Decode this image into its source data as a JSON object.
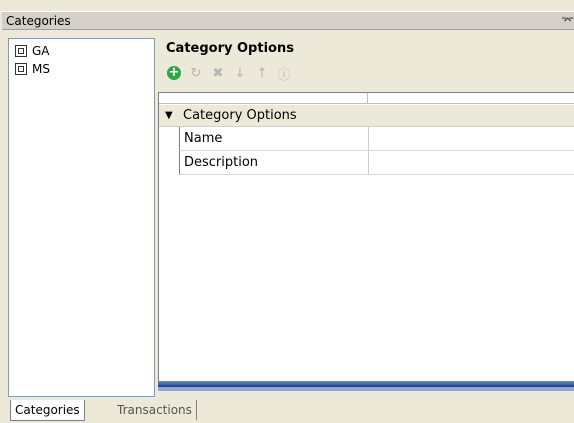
{
  "window": {
    "title": "Categories"
  },
  "tree": {
    "items": [
      {
        "label": "GA"
      },
      {
        "label": "MS"
      }
    ]
  },
  "options": {
    "title": "Category Options",
    "toolbar": [
      {
        "icon": "add-icon",
        "enabled": true
      },
      {
        "icon": "refresh-icon",
        "enabled": false
      },
      {
        "icon": "delete-icon",
        "enabled": false
      },
      {
        "icon": "arrow-down-icon",
        "enabled": false
      },
      {
        "icon": "arrow-up-icon",
        "enabled": false
      },
      {
        "icon": "info-icon",
        "enabled": false
      }
    ]
  },
  "grid": {
    "category": "Category Options",
    "rows": [
      {
        "label": "Name",
        "value": ""
      },
      {
        "label": "Description",
        "value": ""
      }
    ]
  },
  "tabs": [
    {
      "label": "Categories"
    },
    {
      "label": "Transactions"
    }
  ]
}
